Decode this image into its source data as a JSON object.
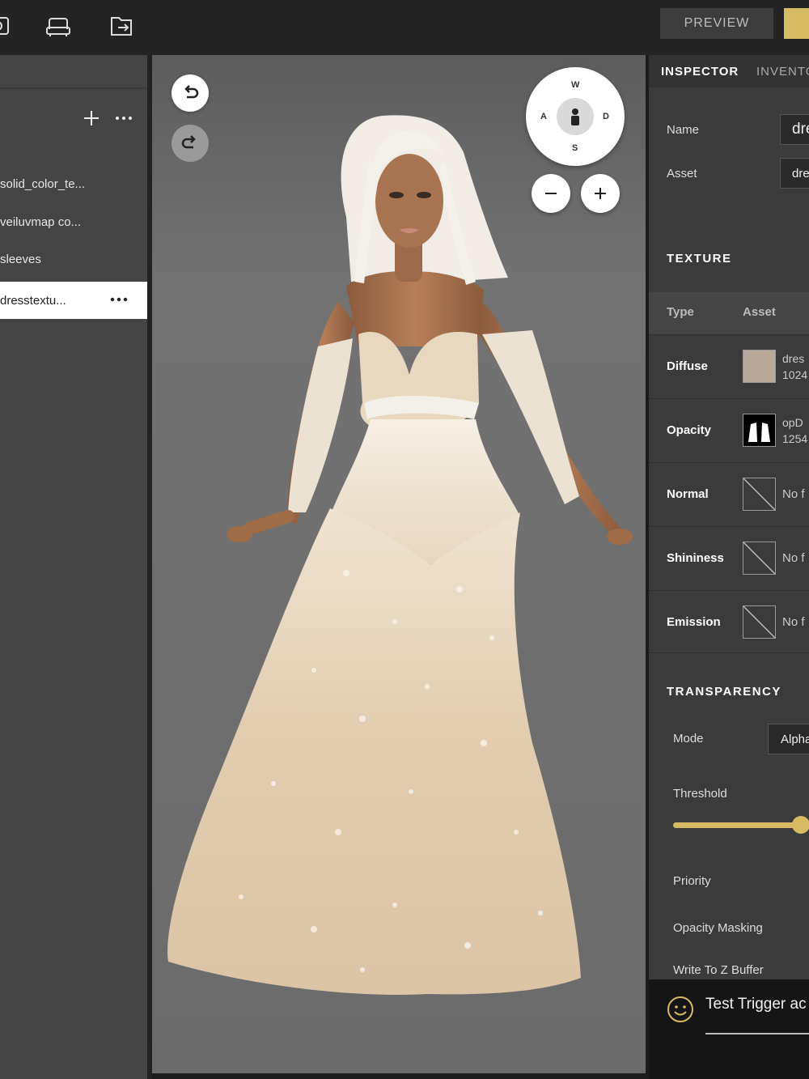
{
  "toolbar": {
    "preview_label": "PREVIEW",
    "icons": [
      "camera-icon",
      "furniture-icon",
      "export-icon"
    ],
    "accent_color": "#d7ba64"
  },
  "layers": {
    "items": [
      {
        "label": "solid_color_te..."
      },
      {
        "label": "veiluvmap co..."
      },
      {
        "label": "sleeves"
      },
      {
        "label": "dresstextu...",
        "selected": true
      }
    ]
  },
  "viewport": {
    "compass": {
      "north": "W",
      "west": "A",
      "east": "D",
      "south": "S"
    }
  },
  "inspector": {
    "tabs": [
      "INSPECTOR",
      "INVENTORY"
    ],
    "name_label": "Name",
    "name_value": "dress",
    "asset_label": "Asset",
    "asset_value": "dress",
    "texture": {
      "title": "TEXTURE",
      "col_type": "Type",
      "col_asset": "Asset",
      "rows": [
        {
          "name": "Diffuse",
          "line1": "dres",
          "line2": "1024"
        },
        {
          "name": "Opacity",
          "line1": "opD",
          "line2": "1254"
        },
        {
          "name": "Normal",
          "none": "No f"
        },
        {
          "name": "Shininess",
          "none": "No f"
        },
        {
          "name": "Emission",
          "none": "No f"
        }
      ]
    },
    "transparency": {
      "title": "TRANSPARENCY",
      "mode_label": "Mode",
      "mode_value": "Alpha",
      "threshold_label": "Threshold",
      "threshold_value": 1.0,
      "priority_label": "Priority",
      "opacity_masking_label": "Opacity Masking",
      "write_z_label": "Write To Z Buffer"
    }
  },
  "chat": {
    "text": "Test Trigger ac"
  }
}
